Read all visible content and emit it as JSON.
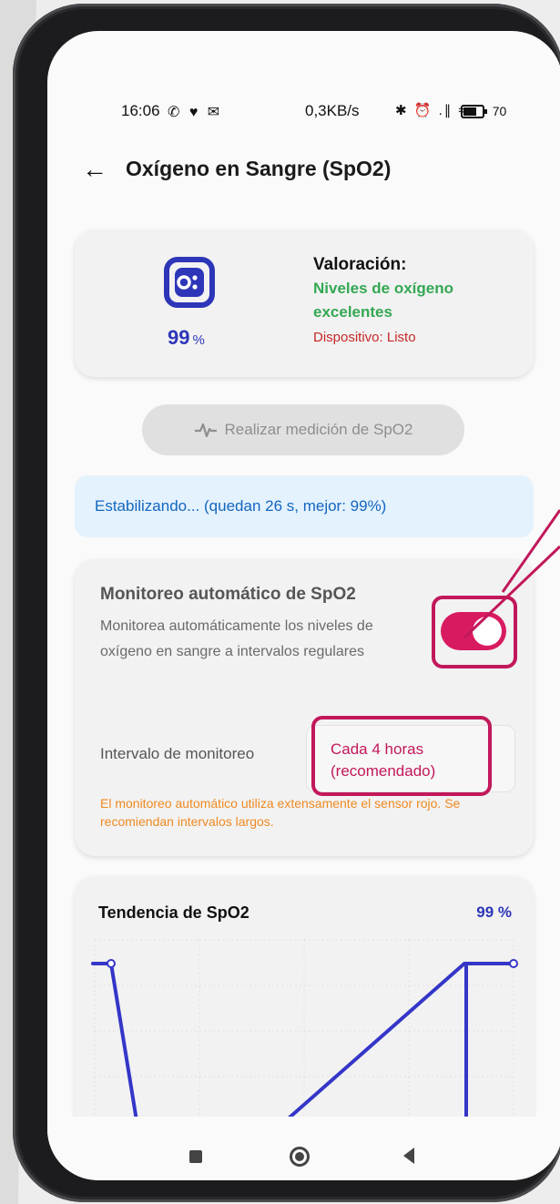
{
  "status_bar": {
    "time": "16:06",
    "left_icons": "✆ ♥ ✉",
    "net_speed": "0,3KB/s",
    "right_icons": "✱ ⏰ .∥ ≈",
    "battery": "70"
  },
  "header": {
    "back_glyph": "←",
    "title": "Oxígeno en Sangre (SpO2)"
  },
  "summary": {
    "icon": "o2-icon",
    "value": "99",
    "unit": "%",
    "assessment_label": "Valoración:",
    "assessment_result": "Niveles de oxígeno excelentes",
    "device_status": "Dispositivo: Listo"
  },
  "measure_button": {
    "icon": "pulse-wave-icon",
    "label": "Realizar medición de SpO2"
  },
  "info_banner": {
    "text": "Estabilizando... (quedan 26 s, mejor: 99%)"
  },
  "monitoring": {
    "title": "Monitoreo automático de SpO2",
    "description": "Monitorea automáticamente los niveles de oxígeno en sangre a intervalos regulares",
    "toggle_on": true,
    "interval_label": "Intervalo de monitoreo",
    "interval_value": "Cada 4 horas (recomendado)",
    "warning": "El monitoreo automático utiliza extensamente el sensor rojo. Se recomiendan intervalos largos."
  },
  "trend": {
    "title": "Tendencia de SpO2",
    "current": "99 %"
  },
  "colors": {
    "accent_blue": "#2d36b8",
    "success_green": "#34a853",
    "error_red": "#c62828",
    "toggle_pink": "#d81b60",
    "highlight": "#c2185b",
    "warning_orange": "#ef8a22",
    "info_bg": "#e3f2fd"
  },
  "nav_bar": {
    "icons": [
      "recents-square-icon",
      "home-circle-icon",
      "back-triangle-icon"
    ]
  }
}
